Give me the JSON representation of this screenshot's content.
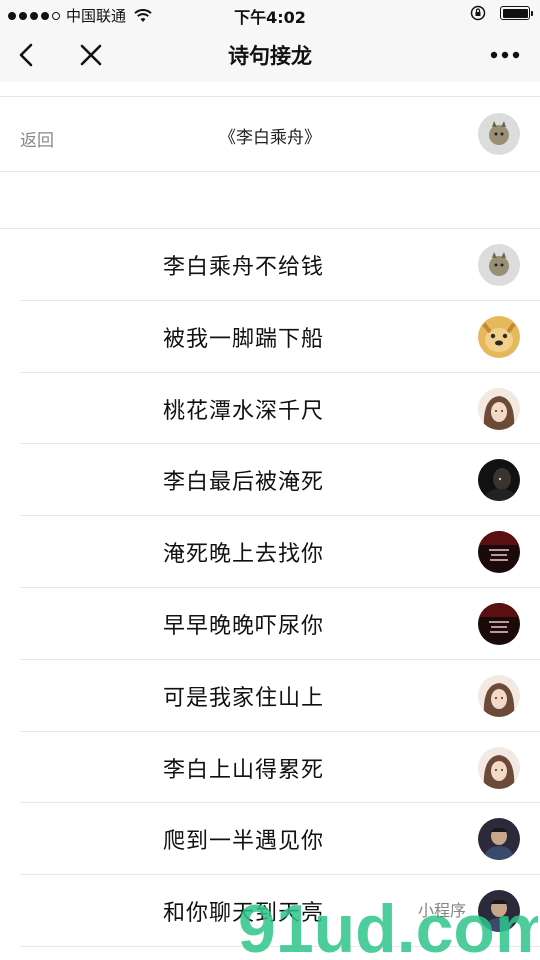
{
  "status_bar": {
    "carrier": "中国联通",
    "time": "下午4:02"
  },
  "nav": {
    "title": "诗句接龙"
  },
  "header": {
    "back_label": "返回",
    "poem_title": "《李白乘舟》"
  },
  "lines": [
    {
      "text": "李白乘舟不给钱"
    },
    {
      "text": "被我一脚踹下船"
    },
    {
      "text": "桃花潭水深千尺"
    },
    {
      "text": "李白最后被淹死"
    },
    {
      "text": "淹死晚上去找你"
    },
    {
      "text": "早早晚晚吓尿你"
    },
    {
      "text": "可是我家住山上"
    },
    {
      "text": "李白上山得累死"
    },
    {
      "text": "爬到一半遇见你"
    },
    {
      "text": "和你聊天到天亮"
    }
  ],
  "watermark": {
    "main": "91ud.com",
    "sub": "小程序"
  }
}
